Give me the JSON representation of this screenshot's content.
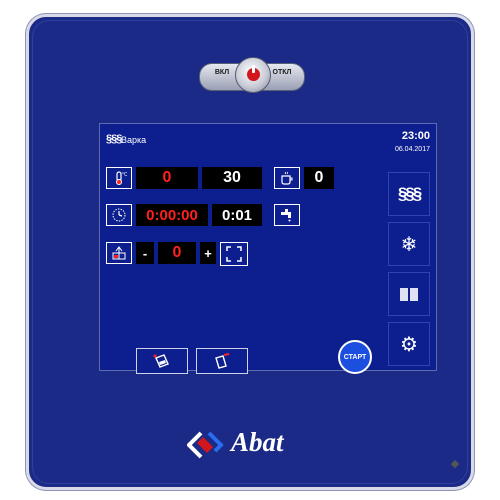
{
  "power_switch": {
    "left_label": "ВКЛ",
    "right_label": "ОТКЛ"
  },
  "header": {
    "mode_icon": "steam-icon",
    "mode_title": "Варка",
    "time": "23:00",
    "date": "06.04.2017"
  },
  "temperature": {
    "icon": "thermometer-icon",
    "set_value": "0",
    "current_value": "30"
  },
  "timer": {
    "icon": "clock-icon",
    "set_value": "0:00:00",
    "current_value": "0:01"
  },
  "humidity": {
    "icon": "humidity-icon",
    "minus": "-",
    "value": "0",
    "plus": "+",
    "expand_icon": "fullscreen-icon"
  },
  "extras": {
    "cup_icon": "cup-icon",
    "cup_value": "0",
    "tap_icon": "tap-icon"
  },
  "side_buttons": [
    {
      "name": "steam-mode-button",
      "icon": "steam-icon"
    },
    {
      "name": "cooling-button",
      "icon": "snowflake-icon"
    },
    {
      "name": "recipe-book-button",
      "icon": "book-icon"
    },
    {
      "name": "settings-button",
      "icon": "gear-icon"
    }
  ],
  "bottom_buttons": [
    {
      "name": "wash-button",
      "icon": "wash-icon"
    },
    {
      "name": "pour-button",
      "icon": "pour-icon"
    }
  ],
  "start_button": {
    "label": "СТАРТ"
  },
  "logo": {
    "text": "Abat"
  },
  "colors": {
    "panel": "#1b2a86",
    "screen": "#0d1f8f",
    "value_red": "#ff2020",
    "start": "#1c4ee0"
  }
}
